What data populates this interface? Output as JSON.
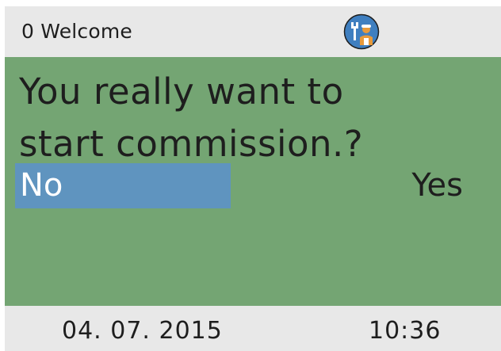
{
  "header": {
    "title": "0 Welcome",
    "icon": "service-technician-icon"
  },
  "dialog": {
    "question": "You really want to\nstart commission.?",
    "no_label": "No",
    "yes_label": "Yes",
    "selected": "No"
  },
  "footer": {
    "date": "04. 07. 2015",
    "time": "10:36"
  },
  "colors": {
    "header_bg": "#e8e8e8",
    "main_bg": "#74a573",
    "selection": "#5f94bf",
    "icon_blue": "#3f7fc0",
    "icon_orange": "#e89a3a"
  }
}
